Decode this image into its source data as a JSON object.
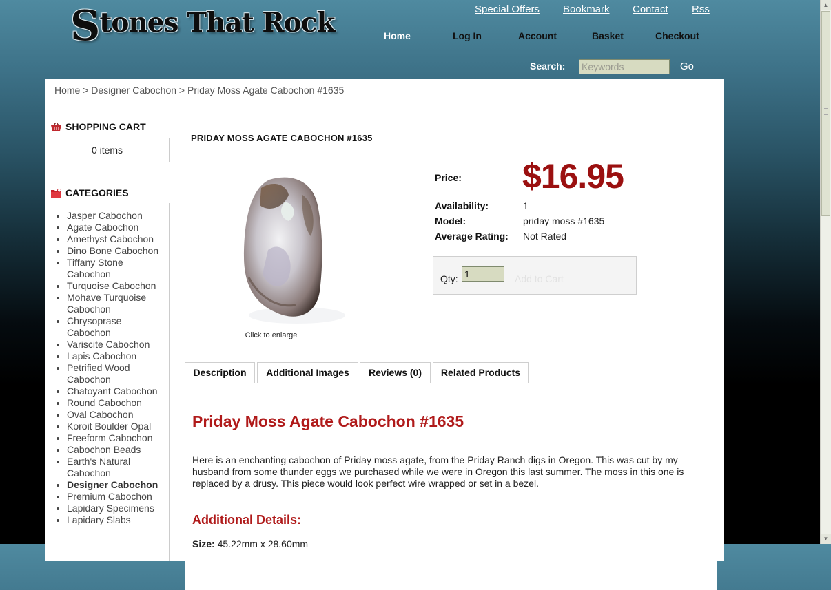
{
  "site": {
    "logo_initial": "S",
    "logo_rest": "tones That Rock"
  },
  "top_links": [
    "Special Offers",
    "Bookmark",
    "Contact",
    "Rss"
  ],
  "nav": [
    "Home",
    "Log In",
    "Account",
    "Basket",
    "Checkout"
  ],
  "search": {
    "label": "Search:",
    "placeholder": "Keywords",
    "button": "Go"
  },
  "breadcrumb": "Home > Designer Cabochon > Priday Moss Agate Cabochon #1635",
  "cart": {
    "title": "SHOPPING CART",
    "items": "0 items"
  },
  "categories": {
    "title": "CATEGORIES",
    "items": [
      "Jasper Cabochon",
      "Agate Cabochon",
      "Amethyst Cabochon",
      "Dino Bone Cabochon",
      "Tiffany Stone Cabochon",
      "Turquoise Cabochon",
      "Mohave Turquoise Cabochon",
      "Chrysoprase Cabochon",
      "Variscite Cabochon",
      "Lapis Cabochon",
      "Petrified Wood Cabochon",
      "Chatoyant Cabochon",
      "Round Cabochon",
      "Oval Cabochon",
      "Koroit Boulder Opal",
      "Freeform Cabochon",
      "Cabochon Beads",
      "Earth's Natural Cabochon",
      "Designer Cabochon",
      "Premium Cabochon",
      "Lapidary Specimens",
      "Lapidary Slabs"
    ],
    "active": "Designer Cabochon"
  },
  "product": {
    "title": "PRIDAY MOSS AGATE CABOCHON #1635",
    "image_caption": "Click to enlarge",
    "price_label": "Price:",
    "price": "$16.95",
    "availability_label": "Availability:",
    "availability": "1",
    "model_label": "Model:",
    "model": "priday moss #1635",
    "rating_label": "Average Rating:",
    "rating": "Not Rated",
    "qty_label": "Qty:",
    "qty_value": "1",
    "add_to_cart": "Add to Cart"
  },
  "tabs": [
    "Description",
    "Additional Images",
    "Reviews (0)",
    "Related Products"
  ],
  "description": {
    "heading": "Priday Moss Agate Cabochon #1635",
    "text": "Here is an enchanting cabochon of Priday moss agate, from the Priday Ranch digs in Oregon. This was cut by my husband from some thunder eggs we purchased while we were in Oregon this last summer. The moss in this one is replaced by a drusy. This piece would look perfect wire wrapped or set in a bezel.",
    "details_heading": "Additional Details:",
    "size_label": "Size:",
    "size_value": "45.22mm x 28.60mm"
  },
  "colors": {
    "price": "#9b1010",
    "heading": "#b01a1a",
    "input_bg": "#d7dbc1"
  }
}
